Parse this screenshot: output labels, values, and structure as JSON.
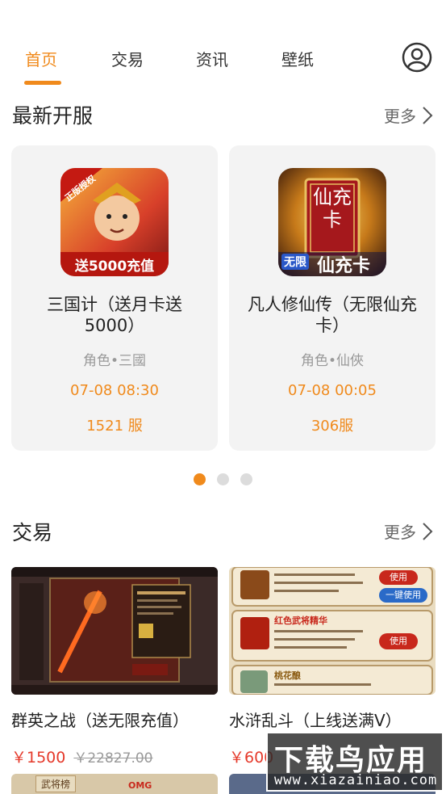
{
  "tabs": {
    "items": [
      {
        "label": "首页",
        "active": true
      },
      {
        "label": "交易",
        "active": false
      },
      {
        "label": "资讯",
        "active": false
      },
      {
        "label": "壁纸",
        "active": false
      }
    ],
    "profile_icon": "user-circle-icon"
  },
  "new_servers": {
    "title": "最新开服",
    "more_label": "更多",
    "cards": [
      {
        "name": "三国计（送月卡送5000）",
        "genre": "角色•三國",
        "time": "07-08 08:30",
        "server": "1521 服",
        "icon_badge": "正版授权",
        "icon_banner": "送5000充值"
      },
      {
        "name": "凡人修仙传（无限仙充卡）",
        "genre": "角色•仙俠",
        "time": "07-08 00:05",
        "server": "306服",
        "icon_text": "仙充卡",
        "icon_banner_small": "无限",
        "icon_banner": "仙充卡"
      }
    ],
    "pager": {
      "count": 3,
      "active_index": 0
    }
  },
  "trade": {
    "title": "交易",
    "more_label": "更多",
    "items": [
      {
        "title": "群英之战（送无限充值）",
        "price": "￥1500",
        "original_price": "￥22827.00"
      },
      {
        "title": "水浒乱斗（上线送满V）",
        "price": "￥600",
        "original_price": ""
      }
    ],
    "screenshot_texts": {
      "use": "使用",
      "use_all": "一键使用",
      "item_a": "红色武将精华",
      "item_b": "桃花酿",
      "row_labels": [
        "武将榜",
        "OMG"
      ]
    }
  },
  "watermark": {
    "main": "下载鸟应用",
    "sub": "www.xiazainiao.com"
  },
  "colors": {
    "accent": "#f08a1c",
    "price": "#e53a2b",
    "card_bg": "#f3f3f3"
  }
}
